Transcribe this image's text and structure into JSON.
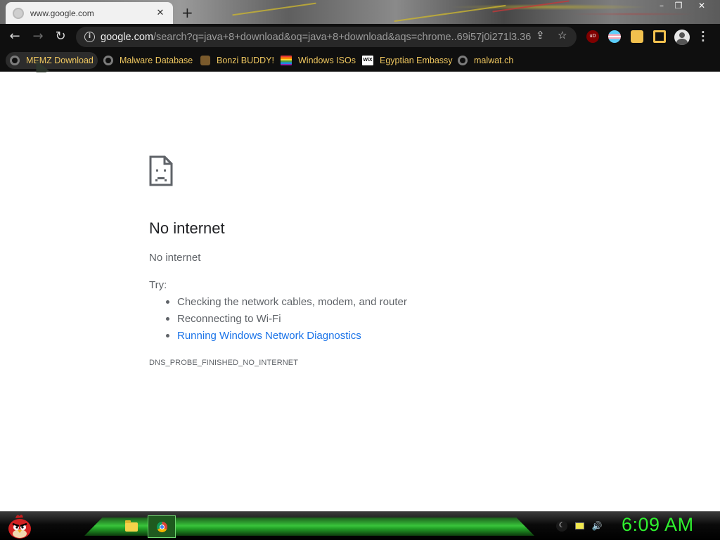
{
  "tab": {
    "title": "www.google.com",
    "close": "✕"
  },
  "window_controls": {
    "minimize": "–",
    "restore": "❐",
    "close": "✕"
  },
  "toolbar": {
    "back": "←",
    "forward": "→",
    "reload": "↻",
    "url_host": "google.com",
    "url_path": "/search?q=java+8+download&oq=java+8+download&aqs=chrome..69i57j0i271l3.36...",
    "share_icon": "share-icon",
    "star_icon": "star-icon"
  },
  "extensions": [
    {
      "name": "ublock-origin-icon",
      "color": "#800000",
      "label": "uD"
    },
    {
      "name": "flag-extension-icon",
      "color": "#f5a9b8"
    },
    {
      "name": "extensions-puzzle-icon",
      "color": "#f2c14e"
    },
    {
      "name": "side-panel-icon",
      "color": "#f2c14e"
    }
  ],
  "bookmarks": [
    {
      "label": "MEMZ Download",
      "icon": "globe"
    },
    {
      "label": "Malware Database",
      "icon": "globe"
    },
    {
      "label": "Bonzi BUDDY!",
      "icon": "bonzi"
    },
    {
      "label": "Windows ISOs",
      "icon": "rainbow"
    },
    {
      "label": "Egyptian Embassy",
      "icon": "wix",
      "icon_text": "WiX"
    },
    {
      "label": "malwat.ch",
      "icon": "globe"
    }
  ],
  "error": {
    "title": "No internet",
    "subtitle": "No internet",
    "try_label": "Try:",
    "suggestions": [
      "Checking the network cables, modem, and router",
      "Reconnecting to Wi-Fi",
      "Running Windows Network Diagnostics"
    ],
    "code": "DNS_PROBE_FINISHED_NO_INTERNET",
    "link_color": "#1a73e8"
  },
  "taskbar": {
    "clock": "6:09 AM",
    "accent": "#2ff02f"
  }
}
